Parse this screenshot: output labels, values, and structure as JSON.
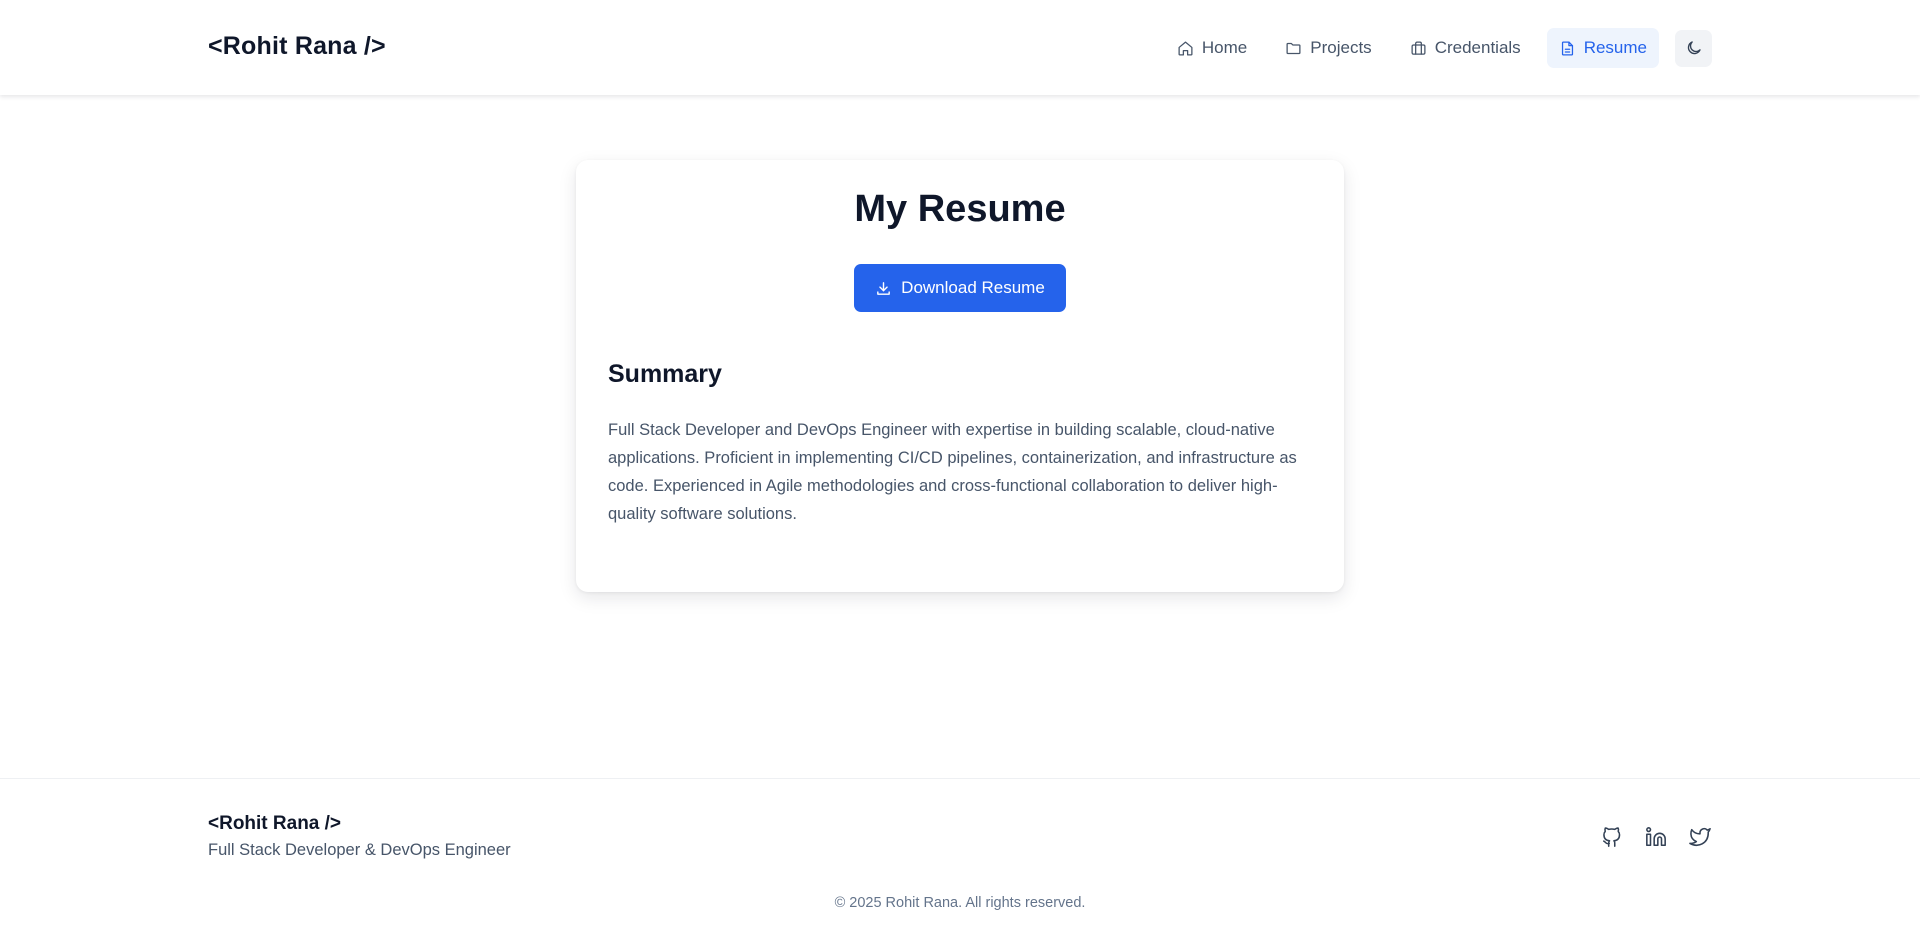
{
  "header": {
    "brand": "<Rohit Rana />",
    "nav": [
      {
        "label": "Home",
        "icon": "home-icon"
      },
      {
        "label": "Projects",
        "icon": "folder-icon"
      },
      {
        "label": "Credentials",
        "icon": "briefcase-icon"
      },
      {
        "label": "Resume",
        "icon": "document-icon",
        "active": true
      }
    ],
    "theme_toggle_icon": "moon-icon"
  },
  "main": {
    "title": "My Resume",
    "download_label": "Download Resume",
    "summary_heading": "Summary",
    "summary_text": "Full Stack Developer and DevOps Engineer with expertise in building scalable, cloud-native applications. Proficient in implementing CI/CD pipelines, containerization, and infrastructure as code. Experienced in Agile methodologies and cross-functional collaboration to deliver high-quality software solutions."
  },
  "footer": {
    "brand": "<Rohit Rana />",
    "tagline": "Full Stack Developer & DevOps Engineer",
    "social": [
      "github-icon",
      "linkedin-icon",
      "twitter-icon"
    ],
    "copyright": "© 2025 Rohit Rana. All rights reserved."
  },
  "colors": {
    "accent": "#2563eb",
    "active_nav_bg": "#eef4fd",
    "text_primary": "#0f172a",
    "text_secondary": "#475569"
  }
}
